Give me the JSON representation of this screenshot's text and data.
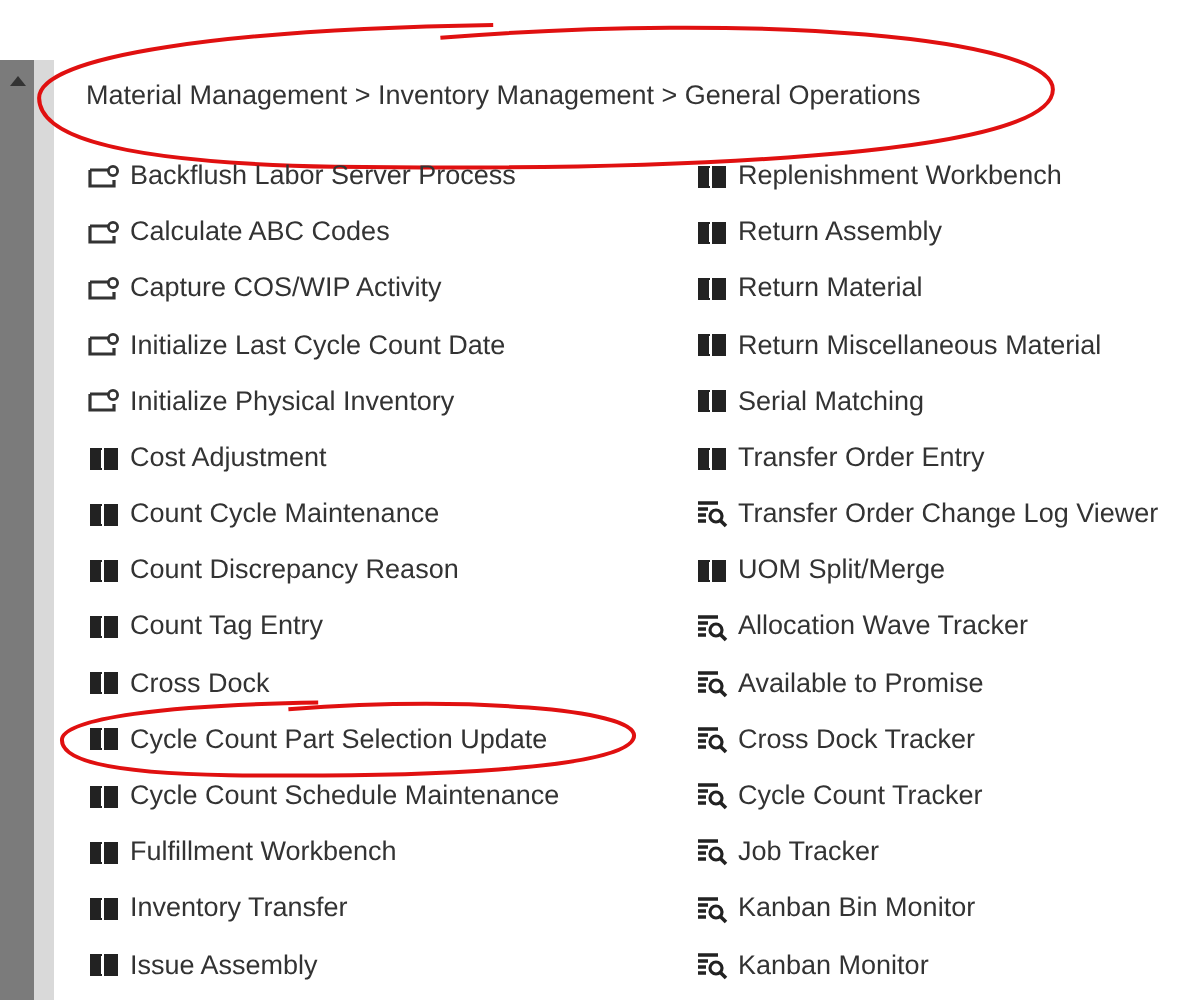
{
  "breadcrumb": {
    "text": "Material Management > Inventory Management > General Operations",
    "highlighted": true
  },
  "columns": [
    {
      "items": [
        {
          "label": "Backflush Labor Server Process",
          "kind": "process",
          "highlighted": false
        },
        {
          "label": "Calculate ABC Codes",
          "kind": "process",
          "highlighted": false
        },
        {
          "label": "Capture COS/WIP Activity",
          "kind": "process",
          "highlighted": false
        },
        {
          "label": "Initialize Last Cycle Count Date",
          "kind": "process",
          "highlighted": false
        },
        {
          "label": "Initialize Physical Inventory",
          "kind": "process",
          "highlighted": false
        },
        {
          "label": "Cost Adjustment",
          "kind": "entry",
          "highlighted": false
        },
        {
          "label": "Count Cycle Maintenance",
          "kind": "entry",
          "highlighted": false
        },
        {
          "label": "Count Discrepancy Reason",
          "kind": "entry",
          "highlighted": false
        },
        {
          "label": "Count Tag Entry",
          "kind": "entry",
          "highlighted": false
        },
        {
          "label": "Cross Dock",
          "kind": "entry",
          "highlighted": false
        },
        {
          "label": "Cycle Count Part Selection Update",
          "kind": "entry",
          "highlighted": true
        },
        {
          "label": "Cycle Count Schedule Maintenance",
          "kind": "entry",
          "highlighted": false
        },
        {
          "label": "Fulfillment Workbench",
          "kind": "entry",
          "highlighted": false
        },
        {
          "label": "Inventory Transfer",
          "kind": "entry",
          "highlighted": false
        },
        {
          "label": "Issue Assembly",
          "kind": "entry",
          "highlighted": false
        }
      ]
    },
    {
      "items": [
        {
          "label": "Replenishment Workbench",
          "kind": "entry",
          "highlighted": false
        },
        {
          "label": "Return Assembly",
          "kind": "entry",
          "highlighted": false
        },
        {
          "label": "Return Material",
          "kind": "entry",
          "highlighted": false
        },
        {
          "label": "Return Miscellaneous Material",
          "kind": "entry",
          "highlighted": false
        },
        {
          "label": "Serial Matching",
          "kind": "entry",
          "highlighted": false
        },
        {
          "label": "Transfer Order Entry",
          "kind": "entry",
          "highlighted": false
        },
        {
          "label": "Transfer Order Change Log Viewer",
          "kind": "tracker",
          "highlighted": false
        },
        {
          "label": "UOM Split/Merge",
          "kind": "entry",
          "highlighted": false
        },
        {
          "label": "Allocation Wave Tracker",
          "kind": "tracker",
          "highlighted": false
        },
        {
          "label": "Available to Promise",
          "kind": "tracker",
          "highlighted": false
        },
        {
          "label": "Cross Dock Tracker",
          "kind": "tracker",
          "highlighted": false
        },
        {
          "label": "Cycle Count Tracker",
          "kind": "tracker",
          "highlighted": false
        },
        {
          "label": "Job Tracker",
          "kind": "tracker",
          "highlighted": false
        },
        {
          "label": "Kanban Bin Monitor",
          "kind": "tracker",
          "highlighted": false
        },
        {
          "label": "Kanban Monitor",
          "kind": "tracker",
          "highlighted": false
        }
      ]
    }
  ]
}
